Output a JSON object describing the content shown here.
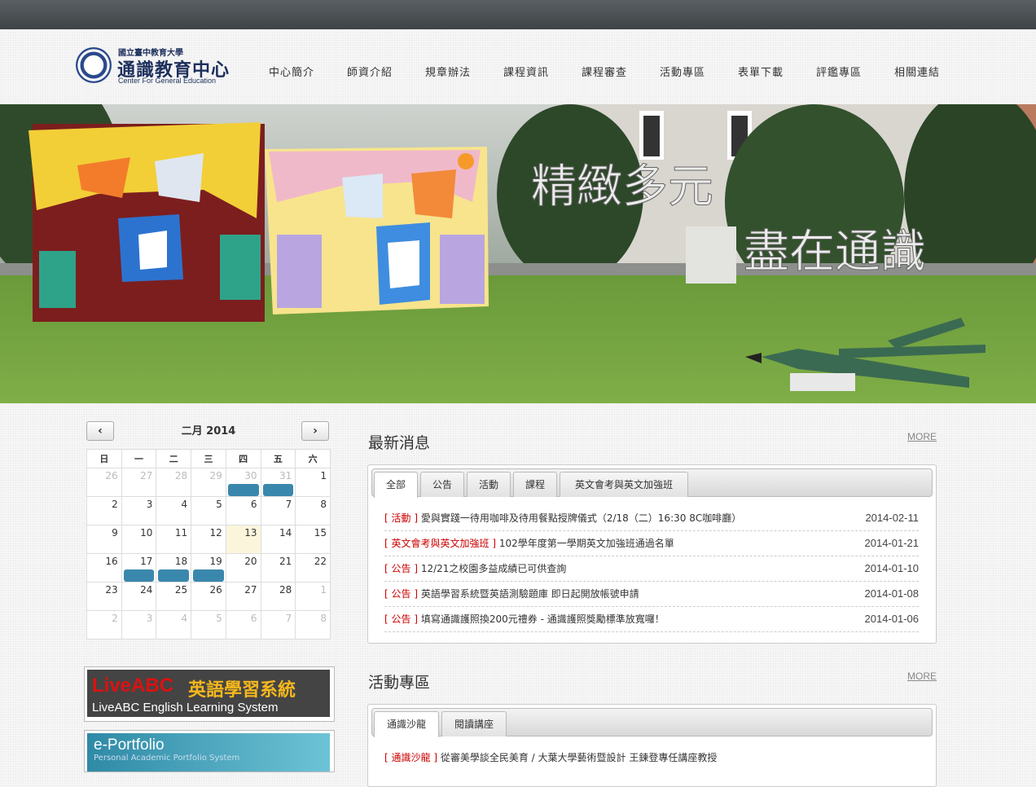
{
  "logo": {
    "line1": "國立臺中教育大學",
    "line2": "通識教育中心",
    "line3": "Center For General Education"
  },
  "nav": [
    "中心簡介",
    "師資介紹",
    "規章辦法",
    "課程資訊",
    "課程審查",
    "活動專區",
    "表單下載",
    "評鑑專區",
    "相關連結"
  ],
  "banner": {
    "slogan1": "精緻多元",
    "slogan2": "盡在通識"
  },
  "calendar": {
    "title": "二月 2014",
    "prev": "‹",
    "next": "›",
    "weekdays": [
      "日",
      "一",
      "二",
      "三",
      "四",
      "五",
      "六"
    ],
    "weeks": [
      [
        "26",
        "27",
        "28",
        "29",
        "30",
        "31",
        "1"
      ],
      [
        "2",
        "3",
        "4",
        "5",
        "6",
        "7",
        "8"
      ],
      [
        "9",
        "10",
        "11",
        "12",
        "13",
        "14",
        "15"
      ],
      [
        "16",
        "17",
        "18",
        "19",
        "20",
        "21",
        "22"
      ],
      [
        "23",
        "24",
        "25",
        "26",
        "27",
        "28",
        "1"
      ],
      [
        "2",
        "3",
        "4",
        "5",
        "6",
        "7",
        "8"
      ]
    ]
  },
  "ads": {
    "liveabc_brand": "LiveABC",
    "liveabc_title": "英語學習系統",
    "liveabc_sub": "LiveABC English Learning System",
    "eportfolio_title": "e-Portfolio",
    "eportfolio_sub": "Personal Academic Portfolio System"
  },
  "news": {
    "title": "最新消息",
    "more": "MORE",
    "tabs": [
      "全部",
      "公告",
      "活動",
      "課程",
      "英文會考與英文加強班"
    ],
    "items": [
      {
        "cat": "活動",
        "text": "愛與實踐一待用咖啡及待用餐點授牌儀式（2/18（二）16:30 8C咖啡廳）",
        "date": "2014-02-11"
      },
      {
        "cat": "英文會考與英文加強班",
        "text": "102學年度第一學期英文加強班通過名單",
        "date": "2014-01-21"
      },
      {
        "cat": "公告",
        "text": "12/21之校園多益成績已可供查詢",
        "date": "2014-01-10"
      },
      {
        "cat": "公告",
        "text": "英語學習系統暨英語測驗題庫 即日起開放帳號申請",
        "date": "2014-01-08"
      },
      {
        "cat": "公告",
        "text": "填寫通識護照換200元禮券 - 通識護照獎勵標準放寬囉！",
        "date": "2014-01-06"
      }
    ]
  },
  "activities": {
    "title": "活動專區",
    "more": "MORE",
    "tabs": [
      "通識沙龍",
      "閱讀講座"
    ],
    "items": [
      {
        "cat": "通識沙龍",
        "text": "從審美學談全民美育 / 大葉大學藝術暨設計 王鍊登專任講座教授"
      }
    ]
  },
  "colors": {
    "topbar": "#45494c",
    "event": "#3a87ad",
    "category": "#cc0000"
  }
}
